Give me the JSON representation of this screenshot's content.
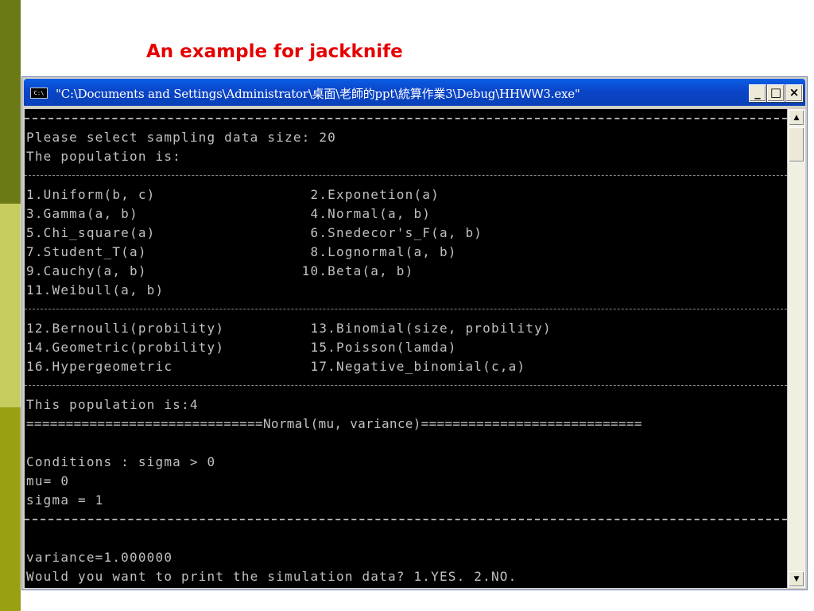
{
  "slide": {
    "title": "An example for jackknife"
  },
  "window": {
    "title": "\"C:\\Documents and Settings\\Administrator\\桌面\\老師的ppt\\統算作業3\\Debug\\HHＷＷ3.exe\"",
    "icon_label": "C:\\",
    "minimize_label": "_",
    "maximize_label": "□",
    "close_label": "×"
  },
  "console": {
    "lines": [
      "",
      "Please select sampling data size: 20",
      "The population is:",
      "",
      "1.Uniform(b, c)                  2.Exponetion(a)",
      "3.Gamma(a, b)                    4.Normal(a, b)",
      "5.Chi_square(a)                  6.Snedecor's_F(a, b)",
      "7.Student_T(a)                   8.Lognormal(a, b)",
      "9.Cauchy(a, b)                  10.Beta(a, b)",
      "11.Weibull(a, b)",
      "",
      "12.Bernoulli(probility)          13.Binomial(size, probility)",
      "14.Geometric(probility)          15.Poisson(lamda)",
      "16.Hypergeometric                17.Negative_binomial(c,a)",
      "",
      "This population is:4",
      "==============================Normal(mu, variance)============================",
      "",
      "Conditions : sigma > 0",
      "mu= 0",
      "sigma = 1",
      "",
      "",
      "variance=1.000000",
      "Would you want to print the simulation data? 1.YES. 2.NO."
    ]
  },
  "scrollbar": {
    "up_arrow": "▲",
    "down_arrow": "▼"
  }
}
